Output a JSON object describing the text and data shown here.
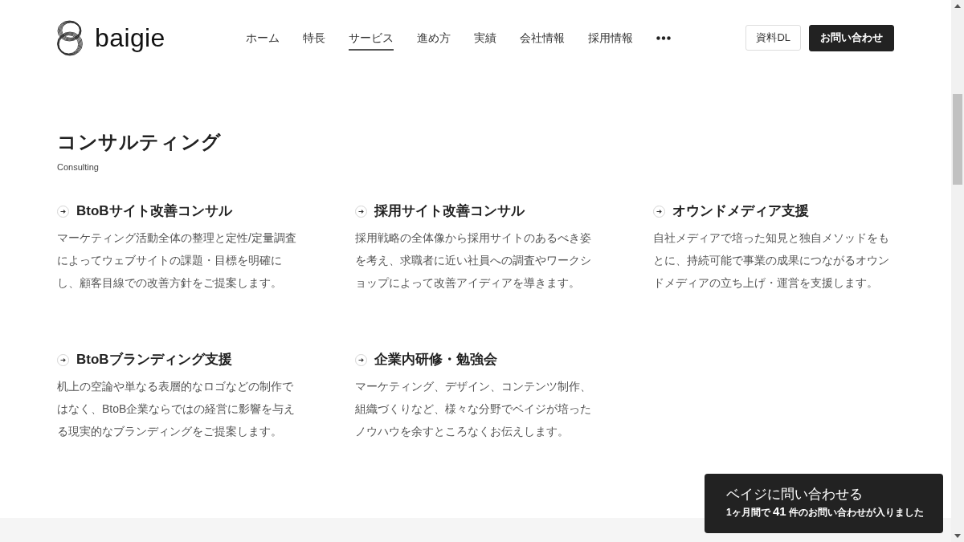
{
  "header": {
    "logo_text": "baigie",
    "nav": [
      {
        "label": "ホーム",
        "selected": false
      },
      {
        "label": "特長",
        "selected": false
      },
      {
        "label": "サービス",
        "selected": true
      },
      {
        "label": "進め方",
        "selected": false
      },
      {
        "label": "実績",
        "selected": false
      },
      {
        "label": "会社情報",
        "selected": false
      },
      {
        "label": "採用情報",
        "selected": false
      }
    ],
    "buttons": [
      {
        "label": "資料DL",
        "kind": "outline"
      },
      {
        "label": "お問い合わせ",
        "kind": "filled"
      }
    ]
  },
  "section": {
    "title": "コンサルティング",
    "subtitle": "Consulting",
    "services": [
      {
        "title": "BtoBサイト改善コンサル",
        "description": "マーケティング活動全体の整理と定性/定量調査によってウェブサイトの課題・目標を明確にし、顧客目線での改善方針をご提案します。"
      },
      {
        "title": "採用サイト改善コンサル",
        "description": "採用戦略の全体像から採用サイトのあるべき姿を考え、求職者に近い社員への調査やワークショップによって改善アイディアを導きます。"
      },
      {
        "title": "オウンドメディア支援",
        "description": "自社メディアで培った知見と独自メソッドをもとに、持続可能で事業の成果につながるオウンドメディアの立ち上げ・運営を支援します。"
      },
      {
        "title": "BtoBブランディング支援",
        "description": "机上の空論や単なる表層的なロゴなどの制作ではなく、BtoB企業ならではの経営に影響を与える現実的なブランディングをご提案します。"
      },
      {
        "title": "企業内研修・勉強会",
        "description": "マーケティング、デザイン、コンテンツ制作、組織づくりなど、様々な分野でベイジが培ったノウハウを余すところなくお伝えします。"
      }
    ]
  },
  "contact_banner": {
    "title": "ベイジに問い合わせる",
    "note": "1ヶ月間で **41** 件のお問い合わせが入りました"
  }
}
